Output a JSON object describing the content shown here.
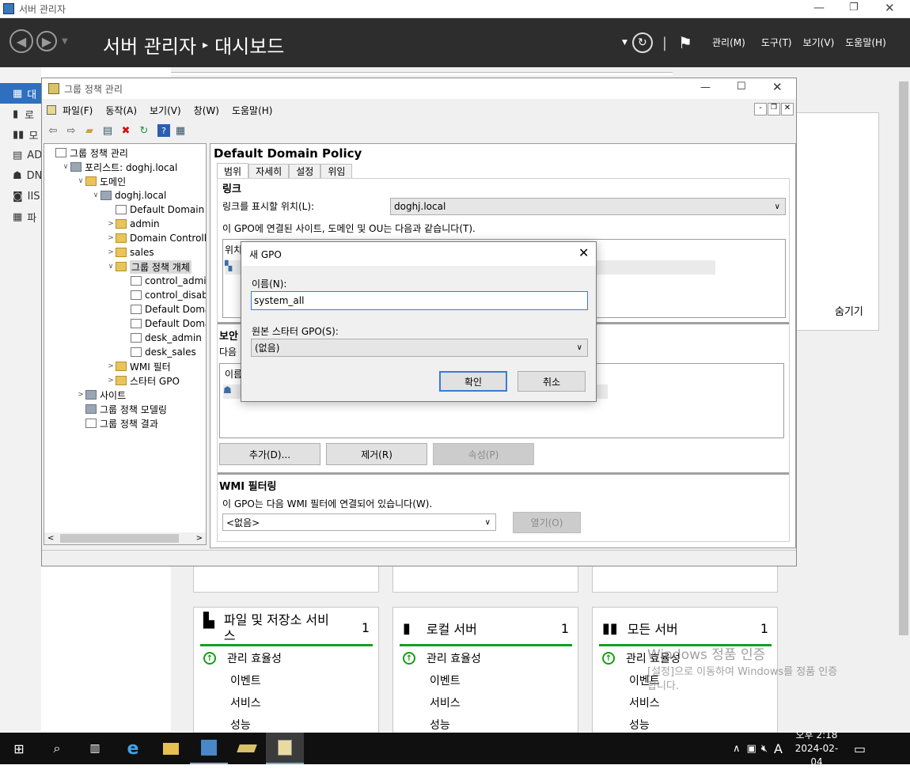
{
  "sm": {
    "window_title": "서버 관리자",
    "breadcrumb_app": "서버 관리자",
    "breadcrumb_sep": "▸",
    "breadcrumb_page": "대시보드",
    "menus": [
      "관리(M)",
      "도구(T)",
      "보기(V)",
      "도움말(H)"
    ],
    "sidebar": [
      "대",
      "로",
      "모",
      "AD",
      "DN",
      "IIS",
      "파"
    ],
    "hide_label": "숨기기",
    "tiles": [
      {
        "title": "파일 및 저장소 서비\n스",
        "count": "1",
        "rows": [
          "관리 효율성",
          "이벤트",
          "서비스",
          "성능"
        ]
      },
      {
        "title": "로컬 서버",
        "count": "1",
        "rows": [
          "관리 효율성",
          "이벤트",
          "서비스",
          "성능"
        ]
      },
      {
        "title": "모든 서버",
        "count": "1",
        "rows": [
          "관리 효율성",
          "이벤트",
          "서비스",
          "성능"
        ]
      }
    ],
    "watermark_line1": "Windows 정품 인증",
    "watermark_line2": "[설정]으로 이동하여 Windows를 정품 인증",
    "watermark_line3": "합니다."
  },
  "gpmc": {
    "title": "그룹 정책 관리",
    "menus": [
      "파일(F)",
      "동작(A)",
      "보기(V)",
      "창(W)",
      "도움말(H)"
    ],
    "tree": [
      {
        "label": "그룹 정책 관리",
        "depth": 0,
        "tw": "",
        "icon": "doc"
      },
      {
        "label": "포리스트: doghj.local",
        "depth": 1,
        "tw": "∨",
        "icon": "ico-gray"
      },
      {
        "label": "도메인",
        "depth": 2,
        "tw": "∨",
        "icon": "fold"
      },
      {
        "label": "doghj.local",
        "depth": 3,
        "tw": "∨",
        "icon": "ico-gray"
      },
      {
        "label": "Default Domain Po",
        "depth": 4,
        "tw": "",
        "icon": "doc"
      },
      {
        "label": "admin",
        "depth": 4,
        "tw": ">",
        "icon": "fold"
      },
      {
        "label": "Domain Controllers",
        "depth": 4,
        "tw": ">",
        "icon": "fold"
      },
      {
        "label": "sales",
        "depth": 4,
        "tw": ">",
        "icon": "fold"
      },
      {
        "label": "그룹 정책 개체",
        "depth": 4,
        "tw": "∨",
        "icon": "fold",
        "selected": true
      },
      {
        "label": "control_admin",
        "depth": 5,
        "tw": "",
        "icon": "doc"
      },
      {
        "label": "control_disable_",
        "depth": 5,
        "tw": "",
        "icon": "doc"
      },
      {
        "label": "Default Domain",
        "depth": 5,
        "tw": "",
        "icon": "doc"
      },
      {
        "label": "Default Domain",
        "depth": 5,
        "tw": "",
        "icon": "doc"
      },
      {
        "label": "desk_admin",
        "depth": 5,
        "tw": "",
        "icon": "doc"
      },
      {
        "label": "desk_sales",
        "depth": 5,
        "tw": "",
        "icon": "doc"
      },
      {
        "label": "WMI 필터",
        "depth": 4,
        "tw": ">",
        "icon": "fold"
      },
      {
        "label": "스타터 GPO",
        "depth": 4,
        "tw": ">",
        "icon": "fold"
      },
      {
        "label": "사이트",
        "depth": 2,
        "tw": ">",
        "icon": "ico-gray"
      },
      {
        "label": "그룹 정책 모델링",
        "depth": 2,
        "tw": "",
        "icon": "ico-gray"
      },
      {
        "label": "그룹 정책 결과",
        "depth": 2,
        "tw": "",
        "icon": "doc"
      }
    ],
    "detail_title": "Default Domain Policy",
    "tabs": [
      "범위",
      "자세히",
      "설정",
      "위임"
    ],
    "links_header": "링크",
    "links_label": "링크를 표시할 위치(L):",
    "links_value": "doghj.local",
    "links_desc": "이 GPO에 연결된 사이트, 도메인 및 OU는 다음과 같습니다(T).",
    "links_col": "위치",
    "security_header": "보안",
    "security_desc": "다음",
    "security_col": "이름",
    "btn_add": "추가(D)...",
    "btn_remove": "제거(R)",
    "btn_props": "속성(P)",
    "wmi_header": "WMI 필터링",
    "wmi_desc": "이 GPO는 다음 WMI 필터에 연결되어 있습니다(W).",
    "wmi_value": "<없음>",
    "btn_open": "열기(O)"
  },
  "dialog": {
    "title": "새 GPO",
    "name_label": "이름(N):",
    "name_value": "system_all",
    "starter_label": "원본 스타터 GPO(S):",
    "starter_value": "(없음)",
    "ok": "확인",
    "cancel": "취소"
  },
  "taskbar": {
    "time": "오후 2:18",
    "date": "2024-02-04",
    "ime": "A"
  }
}
